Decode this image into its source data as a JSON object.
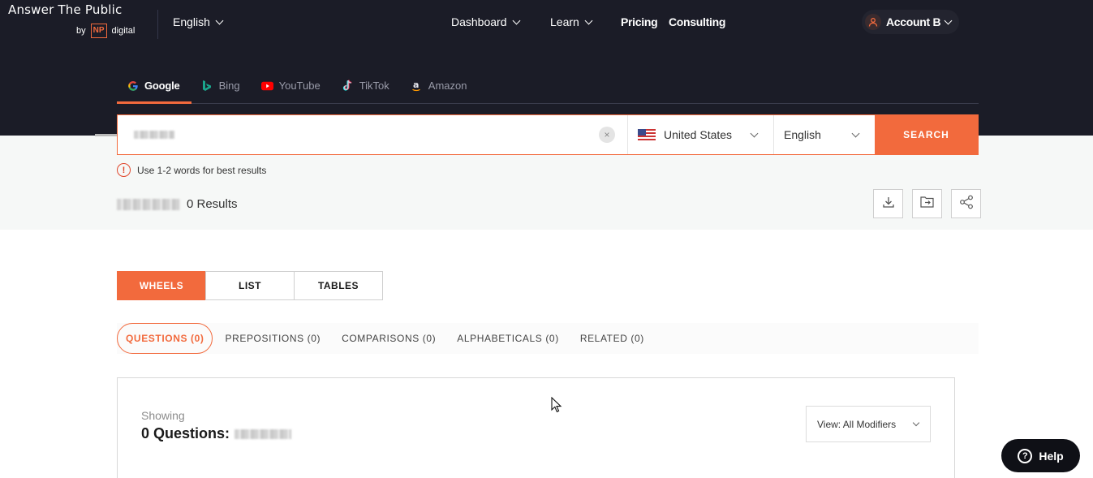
{
  "header": {
    "brand": "Answer The Public",
    "by": "by",
    "np": "NP",
    "np_suffix": "digital",
    "language": "English",
    "nav": [
      "Dashboard",
      "Learn",
      "Pricing",
      "Consulting"
    ],
    "account": "Account B"
  },
  "engines": [
    {
      "label": "Google",
      "icon": "google-icon",
      "active": true
    },
    {
      "label": "Bing",
      "icon": "bing-icon"
    },
    {
      "label": "YouTube",
      "icon": "youtube-icon"
    },
    {
      "label": "TikTok",
      "icon": "tiktok-icon"
    },
    {
      "label": "Amazon",
      "icon": "amazon-icon"
    }
  ],
  "search": {
    "country": "United States",
    "language": "English",
    "submit": "SEARCH",
    "clear": "×"
  },
  "hint": {
    "icon": "!",
    "text": "Use 1-2 words for best results"
  },
  "results": {
    "count_text": "0 Results"
  },
  "tools": [
    "download-icon",
    "save-to-folder-icon",
    "share-icon"
  ],
  "view_tabs": [
    "WHEELS",
    "LIST",
    "TABLES"
  ],
  "modifier_tabs": [
    "QUESTIONS (0)",
    "PREPOSITIONS (0)",
    "COMPARISONS (0)",
    "ALPHABETICALS (0)",
    "RELATED (0)"
  ],
  "panel": {
    "showing": "Showing",
    "count": "0 Questions:",
    "view_filter": "View: All Modifiers"
  },
  "help": {
    "icon": "?",
    "label": "Help"
  },
  "colors": {
    "accent": "#f26a3d",
    "header_bg": "#1b1c27"
  }
}
